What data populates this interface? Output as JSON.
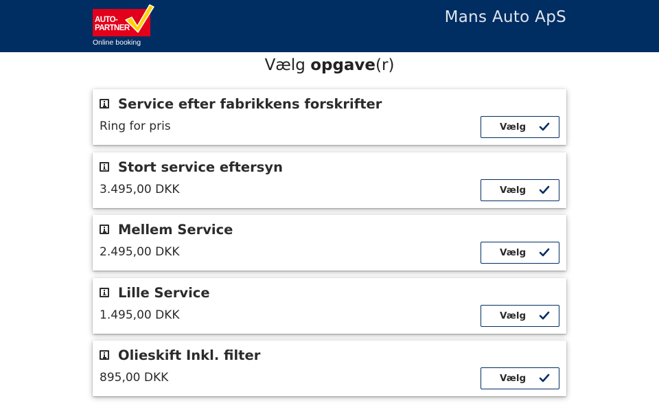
{
  "header": {
    "logo": {
      "line1": "AUTO-",
      "line2": "PARTNER",
      "subtitle": "Online booking",
      "brand_color": "#e2001a",
      "check_color": "#ffd200"
    },
    "shop_name": "Mans Auto ApS",
    "background": "#002d62"
  },
  "page": {
    "title_prefix": "Vælg ",
    "title_bold": "opgave",
    "title_suffix": "(r)"
  },
  "tasks": [
    {
      "title": "Service efter fabrikkens forskrifter",
      "price": "Ring for pris",
      "button": "Vælg"
    },
    {
      "title": "Stort service eftersyn",
      "price": "3.495,00 DKK",
      "button": "Vælg"
    },
    {
      "title": "Mellem Service",
      "price": "2.495,00 DKK",
      "button": "Vælg"
    },
    {
      "title": "Lille Service",
      "price": "1.495,00 DKK",
      "button": "Vælg"
    },
    {
      "title": "Olieskift Inkl. filter",
      "price": "895,00 DKK",
      "button": "Vælg"
    }
  ],
  "icons": {
    "info": "info-icon",
    "check": "check-icon"
  }
}
